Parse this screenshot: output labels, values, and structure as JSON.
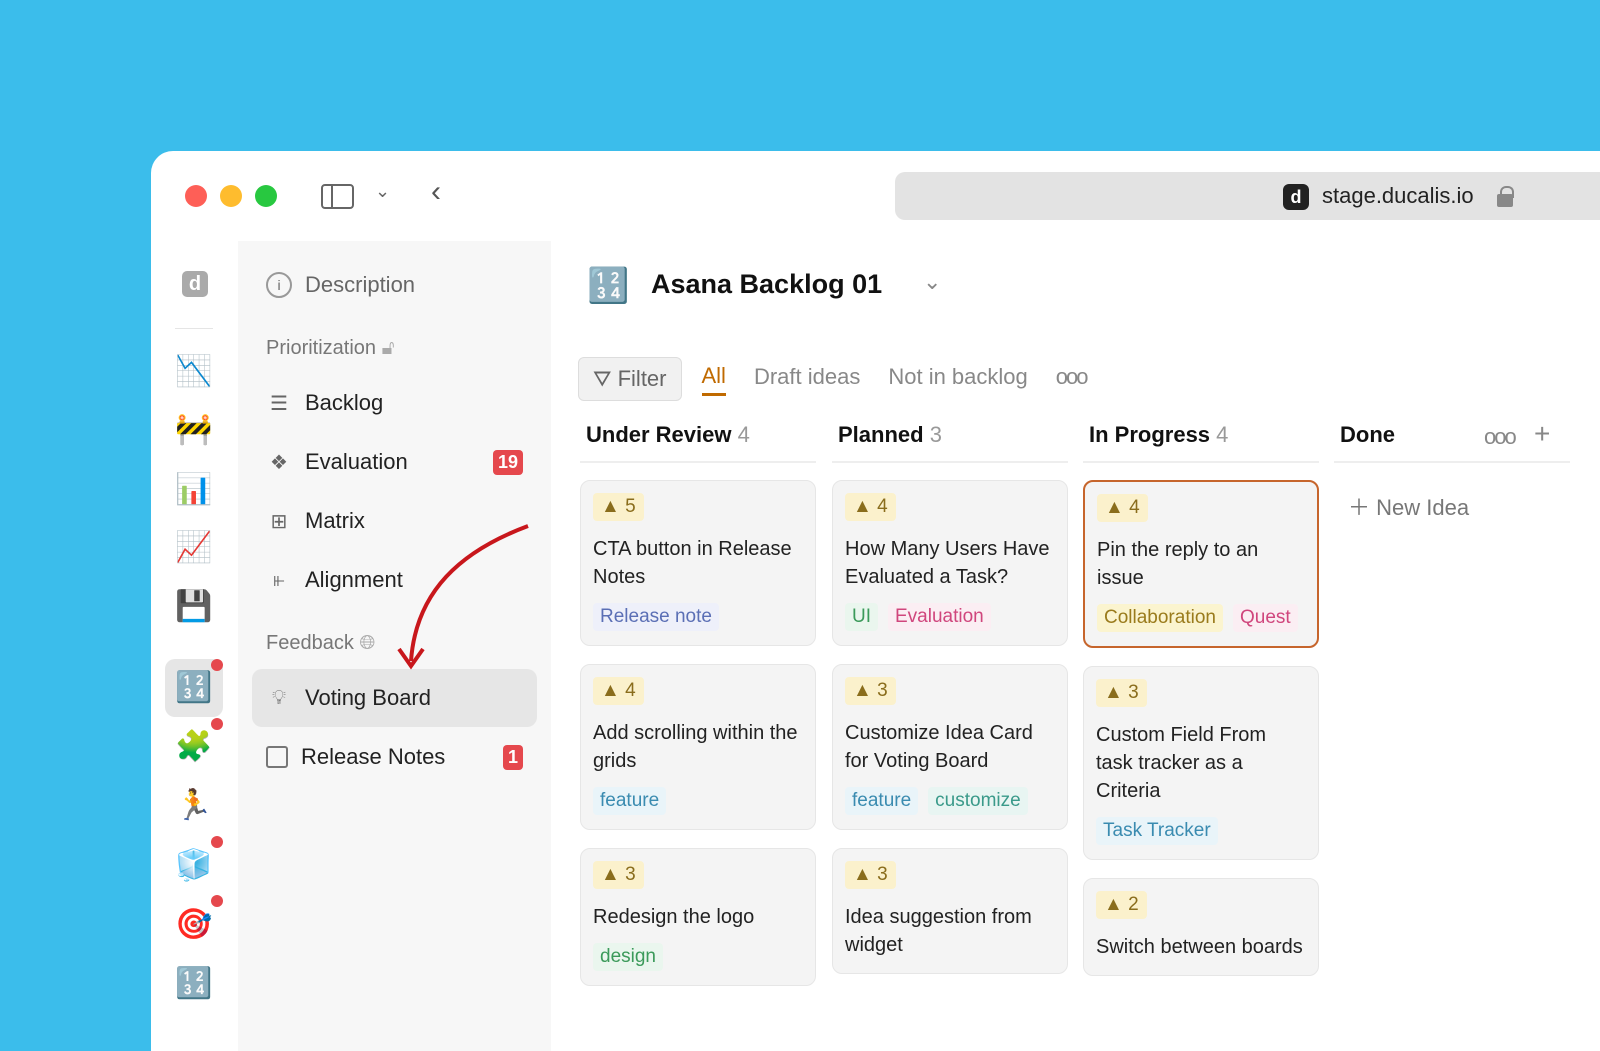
{
  "browser": {
    "url": "stage.ducalis.io",
    "favicon": "d"
  },
  "rail": {
    "logo": "d",
    "icons": [
      "chart-down-icon",
      "construction-icon",
      "bar-chart-icon",
      "chart-up-icon",
      "floppy-disk-icon",
      "numbers-icon",
      "puzzle-icon",
      "runner-icon",
      "ice-cube-icon",
      "target-icon",
      "numbers-icon"
    ]
  },
  "sidebar": {
    "description": "Description",
    "prioritization": "Prioritization",
    "items": [
      {
        "label": "Backlog"
      },
      {
        "label": "Evaluation",
        "badge": "19"
      },
      {
        "label": "Matrix"
      },
      {
        "label": "Alignment"
      }
    ],
    "feedback": "Feedback",
    "feedback_items": [
      {
        "label": "Voting Board",
        "active": true
      },
      {
        "label": "Release Notes",
        "badge": "1"
      }
    ]
  },
  "header": {
    "title": "Asana Backlog 01"
  },
  "tabs": {
    "filter": "Filter",
    "items": [
      "All",
      "Draft ideas",
      "Not in backlog"
    ],
    "active": "All"
  },
  "columns": [
    {
      "name": "Under Review",
      "count": "4",
      "cards": [
        {
          "votes": "5",
          "title": "CTA button in Release Notes",
          "tags": [
            {
              "t": "Release note",
              "c": "#5b6fb5",
              "bg": "#eef0fa"
            }
          ]
        },
        {
          "votes": "4",
          "title": "Add scrolling within the grids",
          "tags": [
            {
              "t": "feature",
              "c": "#3a8bb0",
              "bg": "#e9f4f9"
            }
          ]
        },
        {
          "votes": "3",
          "title": "Redesign the logo",
          "tags": [
            {
              "t": "design",
              "c": "#3b9a5a",
              "bg": "#eaf6ee"
            }
          ]
        }
      ]
    },
    {
      "name": "Planned",
      "count": "3",
      "cards": [
        {
          "votes": "4",
          "title": "How Many Users Have Evaluated a Task?",
          "tags": [
            {
              "t": "UI",
              "c": "#3b9a5a",
              "bg": "#eaf6ee"
            },
            {
              "t": "Evaluation",
              "c": "#d0467d",
              "bg": "#fbeef3"
            }
          ]
        },
        {
          "votes": "3",
          "title": "Customize Idea Card for Voting Board",
          "tags": [
            {
              "t": "feature",
              "c": "#3a8bb0",
              "bg": "#e9f4f9"
            },
            {
              "t": "customize",
              "c": "#3a9a8a",
              "bg": "#e8f5f2"
            }
          ]
        },
        {
          "votes": "3",
          "title": "Idea suggestion from widget",
          "tags": []
        }
      ]
    },
    {
      "name": "In Progress",
      "count": "4",
      "cards": [
        {
          "votes": "4",
          "title": "Pin the reply to an issue",
          "highlight": true,
          "tags": [
            {
              "t": "Collaboration",
              "c": "#9a7b1c",
              "bg": "#fbf4cf"
            },
            {
              "t": "Quest",
              "c": "#d0467d",
              "bg": "#fbeef3"
            }
          ]
        },
        {
          "votes": "3",
          "title": "Custom Field From task tracker as a Criteria",
          "tags": [
            {
              "t": "Task Tracker",
              "c": "#3a8bb0",
              "bg": "#e9f4f9"
            }
          ]
        },
        {
          "votes": "2",
          "title": "Switch between boards",
          "tags": []
        }
      ]
    },
    {
      "name": "Done",
      "count": "",
      "new_idea": "New Idea"
    }
  ]
}
